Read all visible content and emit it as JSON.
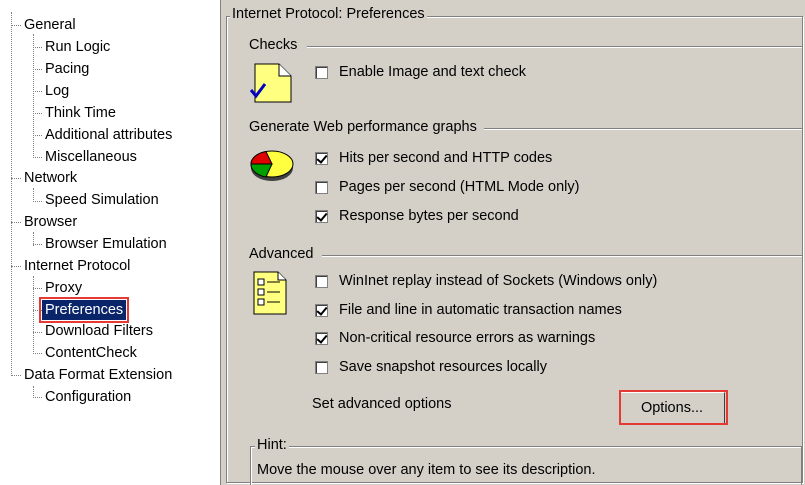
{
  "tree": {
    "items": [
      {
        "label": "General",
        "level": 0
      },
      {
        "label": "Run Logic",
        "level": 1
      },
      {
        "label": "Pacing",
        "level": 1
      },
      {
        "label": "Log",
        "level": 1
      },
      {
        "label": "Think Time",
        "level": 1
      },
      {
        "label": "Additional attributes",
        "level": 1
      },
      {
        "label": "Miscellaneous",
        "level": 1
      },
      {
        "label": "Network",
        "level": 0
      },
      {
        "label": "Speed Simulation",
        "level": 1
      },
      {
        "label": "Browser",
        "level": 0
      },
      {
        "label": "Browser Emulation",
        "level": 1
      },
      {
        "label": "Internet Protocol",
        "level": 0
      },
      {
        "label": "Proxy",
        "level": 1
      },
      {
        "label": "Preferences",
        "level": 1,
        "selected": true
      },
      {
        "label": "Download Filters",
        "level": 1
      },
      {
        "label": "ContentCheck",
        "level": 1
      },
      {
        "label": "Data Format Extension",
        "level": 0
      },
      {
        "label": "Configuration",
        "level": 1
      }
    ]
  },
  "panel": {
    "title": "Internet Protocol: Preferences",
    "checks": {
      "title": "Checks",
      "icon": "document-check-icon",
      "items": [
        {
          "label": "Enable Image and text check",
          "checked": false
        }
      ]
    },
    "graphs": {
      "title": "Generate Web performance graphs",
      "icon": "pie-chart-icon",
      "items": [
        {
          "label": "Hits per second and HTTP codes",
          "checked": true
        },
        {
          "label": "Pages per second (HTML Mode only)",
          "checked": false
        },
        {
          "label": "Response bytes per second",
          "checked": true
        }
      ]
    },
    "advanced": {
      "title": "Advanced",
      "icon": "checklist-icon",
      "items": [
        {
          "label": "WinInet replay instead of Sockets (Windows only)",
          "checked": false
        },
        {
          "label": "File and line in automatic transaction names",
          "checked": true
        },
        {
          "label": "Non-critical resource errors as warnings",
          "checked": true
        },
        {
          "label": "Save snapshot resources locally",
          "checked": false
        }
      ],
      "options_label": "Set advanced options",
      "options_button": "Options..."
    },
    "hint": {
      "title": "Hint:",
      "text": "Move the mouse over any item to see its description."
    }
  },
  "colors": {
    "highlight": "#e53935",
    "panel_bg": "#d4d0c8"
  }
}
